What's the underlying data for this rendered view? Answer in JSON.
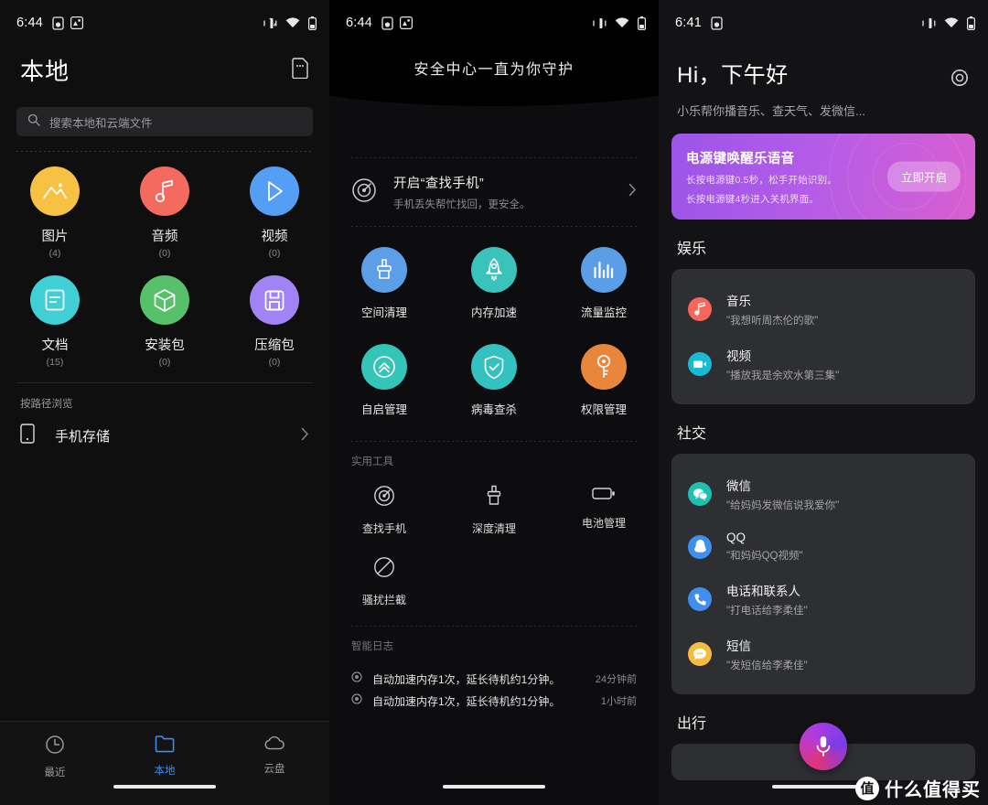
{
  "statusbar": {
    "time_p1": "6:44",
    "time_p2": "6:44",
    "time_p3": "6:41",
    "left_icons": [
      "sim-card-icon",
      "app-badge-icon"
    ],
    "right_icons": [
      "vibrate-icon",
      "wifi-icon",
      "battery-icon"
    ]
  },
  "panel1": {
    "title": "本地",
    "header_icon": "sd-card-icon",
    "search": {
      "placeholder": "搜索本地和云端文件",
      "icon": "search-icon"
    },
    "categories": [
      {
        "name": "图片",
        "count": "(4)",
        "color": "#f7c243",
        "icon": "image-icon"
      },
      {
        "name": "音频",
        "count": "(0)",
        "color": "#f56a5f",
        "icon": "music-note-icon"
      },
      {
        "name": "视频",
        "count": "(0)",
        "color": "#559ef5",
        "icon": "play-icon"
      },
      {
        "name": "文档",
        "count": "(15)",
        "color": "#3fcfd5",
        "icon": "document-icon"
      },
      {
        "name": "安装包",
        "count": "(0)",
        "color": "#56c06a",
        "icon": "package-icon"
      },
      {
        "name": "压缩包",
        "count": "(0)",
        "color": "#a283f5",
        "icon": "archive-icon"
      }
    ],
    "browse_label": "按路径浏览",
    "storage": {
      "name": "手机存储",
      "icon": "phone-storage-icon",
      "chevron": "chevron-right-icon"
    },
    "tabs": [
      {
        "label": "最近",
        "icon": "clock-icon",
        "active": false
      },
      {
        "label": "本地",
        "icon": "folder-icon",
        "active": true
      },
      {
        "label": "云盘",
        "icon": "cloud-icon",
        "active": false
      }
    ],
    "accent": "#3b8cf0"
  },
  "panel2": {
    "hero_title": "安全中心一直为你守护",
    "find_phone": {
      "title": "开启“查找手机”",
      "subtitle": "手机丢失帮忙找回，更安全。",
      "icon": "find-phone-icon",
      "chevron": "chevron-right-icon"
    },
    "features": [
      {
        "label": "空间清理",
        "color": "#5d9ee8",
        "icon": "broom-icon"
      },
      {
        "label": "内存加速",
        "color": "#39c3bb",
        "icon": "rocket-icon"
      },
      {
        "label": "流量监控",
        "color": "#5b9ee8",
        "icon": "bar-chart-icon"
      },
      {
        "label": "自启管理",
        "color": "#35c4b8",
        "icon": "double-chevron-up-icon"
      },
      {
        "label": "病毒查杀",
        "color": "#33c2bf",
        "icon": "shield-check-icon"
      },
      {
        "label": "权限管理",
        "color": "#e8873c",
        "icon": "key-icon"
      }
    ],
    "tools_label": "实用工具",
    "tools": [
      {
        "label": "查找手机",
        "icon": "target-icon"
      },
      {
        "label": "深度清理",
        "icon": "broom-outline-icon"
      },
      {
        "label": "电池管理",
        "icon": "battery-outline-icon"
      },
      {
        "label": "骚扰拦截",
        "icon": "block-icon"
      }
    ],
    "log_label": "智能日志",
    "logs": [
      {
        "text": "自动加速内存1次，延长待机约1分钟。",
        "time": "24分钟前"
      },
      {
        "text": "自动加速内存1次，延长待机约1分钟。",
        "time": "1小时前"
      }
    ]
  },
  "panel3": {
    "greeting": "Hi，下午好",
    "subtitle": "小乐帮你播音乐、查天气、发微信...",
    "gear_icon": "gear-icon",
    "banner": {
      "title": "电源键唤醒乐语音",
      "line1": "长按电源键0.5秒，松手开始识别。",
      "line2": "长按电源键4秒进入关机界面。",
      "button": "立即开启",
      "gradient_from": "#9b55e8",
      "gradient_to": "#d95fd0"
    },
    "sections": [
      {
        "title": "娱乐",
        "items": [
          {
            "name": "音乐",
            "hint": "\"我想听周杰伦的歌\"",
            "color": "#f9665c",
            "icon": "music-note-icon"
          },
          {
            "name": "视频",
            "hint": "\"播放我是余欢水第三集\"",
            "color": "#17bcd4",
            "icon": "video-icon"
          }
        ]
      },
      {
        "title": "社交",
        "items": [
          {
            "name": "微信",
            "hint": "\"给妈妈发微信说我爱你\"",
            "color": "#1fc0b0",
            "icon": "wechat-icon"
          },
          {
            "name": "QQ",
            "hint": "\"和妈妈QQ视频\"",
            "color": "#3f8ef0",
            "icon": "qq-penguin-icon"
          },
          {
            "name": "电话和联系人",
            "hint": "\"打电话给李柔佳\"",
            "color": "#3f8ef0",
            "icon": "phone-icon"
          },
          {
            "name": "短信",
            "hint": "\"发短信给李柔佳\"",
            "color": "#f7bb3f",
            "icon": "message-icon"
          }
        ]
      },
      {
        "title": "出行",
        "items": []
      }
    ],
    "mic_icon": "microphone-icon"
  },
  "watermark": {
    "logo": "值",
    "text": "什么值得买"
  }
}
